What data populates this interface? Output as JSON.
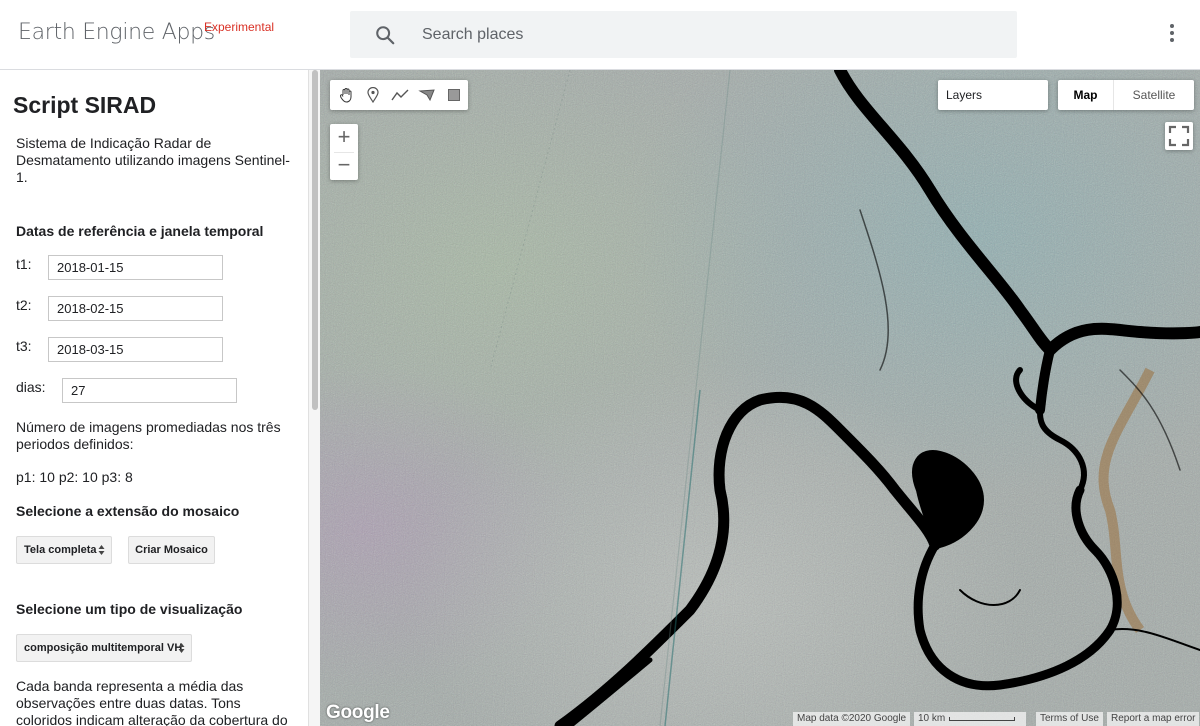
{
  "header": {
    "brand": "Earth Engine Apps",
    "badge": "Experimental",
    "search_placeholder": "Search places",
    "menu_icon": "more-vert-icon"
  },
  "panel": {
    "title": "Script SIRAD",
    "description": "Sistema de Indicação Radar de Desmatamento utilizando imagens Sentinel-1.",
    "dates_heading": "Datas de referência e janela temporal",
    "fields": [
      {
        "label": "t1:",
        "value": "2018-01-15"
      },
      {
        "label": "t2:",
        "value": "2018-02-15"
      },
      {
        "label": "t3:",
        "value": "2018-03-15"
      },
      {
        "label": "dias:",
        "value": "27"
      }
    ],
    "count_text": "Número de imagens promediadas nos três periodos definidos:",
    "count_values": "p1: 10 p2: 10 p3: 8",
    "mosaic_heading": "Selecione a extensão do mosaico",
    "mosaic_select": "Tela completa",
    "mosaic_button": "Criar Mosaico",
    "viz_heading": "Selecione um tipo de visualização",
    "viz_select": "composição multitemporal VH",
    "viz_note": "Cada banda representa a média das observações entre duas datas. Tons coloridos indicam alteração da cobertura do"
  },
  "map": {
    "layers_label": "Layers",
    "map_type": {
      "map": "Map",
      "satellite": "Satellite"
    },
    "zoom_in": "+",
    "zoom_out": "−",
    "logo": "Google",
    "map_data": "Map data ©2020 Google",
    "scale": "10 km",
    "terms": "Terms of Use",
    "report": "Report a map error",
    "draw_tools": [
      "hand-icon",
      "marker-icon",
      "line-icon",
      "polygon-icon",
      "rectangle-icon"
    ]
  }
}
